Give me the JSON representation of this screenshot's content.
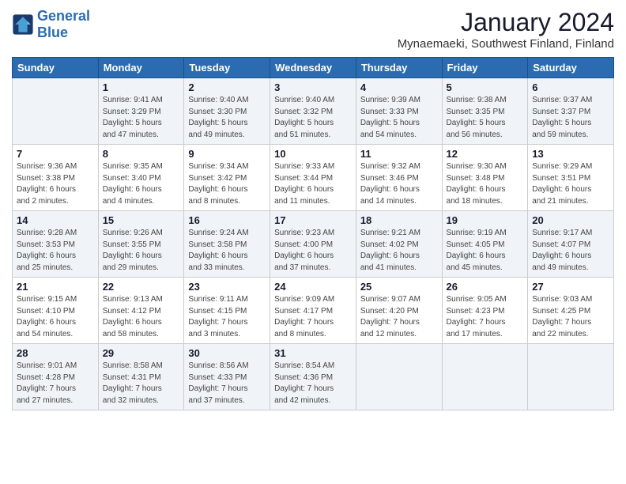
{
  "logo": {
    "line1": "General",
    "line2": "Blue"
  },
  "title": "January 2024",
  "subtitle": "Mynaemaeki, Southwest Finland, Finland",
  "days_header": [
    "Sunday",
    "Monday",
    "Tuesday",
    "Wednesday",
    "Thursday",
    "Friday",
    "Saturday"
  ],
  "weeks": [
    [
      {
        "day": "",
        "info": ""
      },
      {
        "day": "1",
        "info": "Sunrise: 9:41 AM\nSunset: 3:29 PM\nDaylight: 5 hours\nand 47 minutes."
      },
      {
        "day": "2",
        "info": "Sunrise: 9:40 AM\nSunset: 3:30 PM\nDaylight: 5 hours\nand 49 minutes."
      },
      {
        "day": "3",
        "info": "Sunrise: 9:40 AM\nSunset: 3:32 PM\nDaylight: 5 hours\nand 51 minutes."
      },
      {
        "day": "4",
        "info": "Sunrise: 9:39 AM\nSunset: 3:33 PM\nDaylight: 5 hours\nand 54 minutes."
      },
      {
        "day": "5",
        "info": "Sunrise: 9:38 AM\nSunset: 3:35 PM\nDaylight: 5 hours\nand 56 minutes."
      },
      {
        "day": "6",
        "info": "Sunrise: 9:37 AM\nSunset: 3:37 PM\nDaylight: 5 hours\nand 59 minutes."
      }
    ],
    [
      {
        "day": "7",
        "info": "Sunrise: 9:36 AM\nSunset: 3:38 PM\nDaylight: 6 hours\nand 2 minutes."
      },
      {
        "day": "8",
        "info": "Sunrise: 9:35 AM\nSunset: 3:40 PM\nDaylight: 6 hours\nand 4 minutes."
      },
      {
        "day": "9",
        "info": "Sunrise: 9:34 AM\nSunset: 3:42 PM\nDaylight: 6 hours\nand 8 minutes."
      },
      {
        "day": "10",
        "info": "Sunrise: 9:33 AM\nSunset: 3:44 PM\nDaylight: 6 hours\nand 11 minutes."
      },
      {
        "day": "11",
        "info": "Sunrise: 9:32 AM\nSunset: 3:46 PM\nDaylight: 6 hours\nand 14 minutes."
      },
      {
        "day": "12",
        "info": "Sunrise: 9:30 AM\nSunset: 3:48 PM\nDaylight: 6 hours\nand 18 minutes."
      },
      {
        "day": "13",
        "info": "Sunrise: 9:29 AM\nSunset: 3:51 PM\nDaylight: 6 hours\nand 21 minutes."
      }
    ],
    [
      {
        "day": "14",
        "info": "Sunrise: 9:28 AM\nSunset: 3:53 PM\nDaylight: 6 hours\nand 25 minutes."
      },
      {
        "day": "15",
        "info": "Sunrise: 9:26 AM\nSunset: 3:55 PM\nDaylight: 6 hours\nand 29 minutes."
      },
      {
        "day": "16",
        "info": "Sunrise: 9:24 AM\nSunset: 3:58 PM\nDaylight: 6 hours\nand 33 minutes."
      },
      {
        "day": "17",
        "info": "Sunrise: 9:23 AM\nSunset: 4:00 PM\nDaylight: 6 hours\nand 37 minutes."
      },
      {
        "day": "18",
        "info": "Sunrise: 9:21 AM\nSunset: 4:02 PM\nDaylight: 6 hours\nand 41 minutes."
      },
      {
        "day": "19",
        "info": "Sunrise: 9:19 AM\nSunset: 4:05 PM\nDaylight: 6 hours\nand 45 minutes."
      },
      {
        "day": "20",
        "info": "Sunrise: 9:17 AM\nSunset: 4:07 PM\nDaylight: 6 hours\nand 49 minutes."
      }
    ],
    [
      {
        "day": "21",
        "info": "Sunrise: 9:15 AM\nSunset: 4:10 PM\nDaylight: 6 hours\nand 54 minutes."
      },
      {
        "day": "22",
        "info": "Sunrise: 9:13 AM\nSunset: 4:12 PM\nDaylight: 6 hours\nand 58 minutes."
      },
      {
        "day": "23",
        "info": "Sunrise: 9:11 AM\nSunset: 4:15 PM\nDaylight: 7 hours\nand 3 minutes."
      },
      {
        "day": "24",
        "info": "Sunrise: 9:09 AM\nSunset: 4:17 PM\nDaylight: 7 hours\nand 8 minutes."
      },
      {
        "day": "25",
        "info": "Sunrise: 9:07 AM\nSunset: 4:20 PM\nDaylight: 7 hours\nand 12 minutes."
      },
      {
        "day": "26",
        "info": "Sunrise: 9:05 AM\nSunset: 4:23 PM\nDaylight: 7 hours\nand 17 minutes."
      },
      {
        "day": "27",
        "info": "Sunrise: 9:03 AM\nSunset: 4:25 PM\nDaylight: 7 hours\nand 22 minutes."
      }
    ],
    [
      {
        "day": "28",
        "info": "Sunrise: 9:01 AM\nSunset: 4:28 PM\nDaylight: 7 hours\nand 27 minutes."
      },
      {
        "day": "29",
        "info": "Sunrise: 8:58 AM\nSunset: 4:31 PM\nDaylight: 7 hours\nand 32 minutes."
      },
      {
        "day": "30",
        "info": "Sunrise: 8:56 AM\nSunset: 4:33 PM\nDaylight: 7 hours\nand 37 minutes."
      },
      {
        "day": "31",
        "info": "Sunrise: 8:54 AM\nSunset: 4:36 PM\nDaylight: 7 hours\nand 42 minutes."
      },
      {
        "day": "",
        "info": ""
      },
      {
        "day": "",
        "info": ""
      },
      {
        "day": "",
        "info": ""
      }
    ]
  ]
}
